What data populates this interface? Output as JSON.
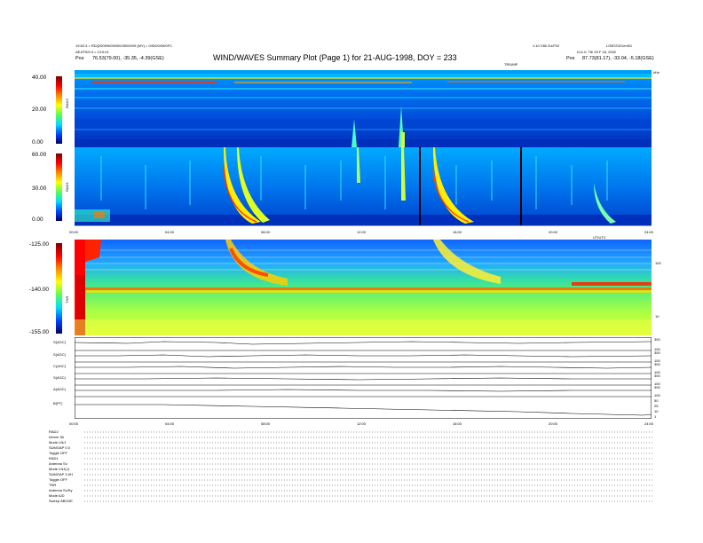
{
  "header": {
    "title": "WIND/WAVES Summary Plot (Page 1) for 21-AUG-1998, DOY = 233",
    "left_line1": "19:52:3 = RD/[2009/9/09/000/39/09/09 (MY) = 0/9/0/0/09/0FC",
    "left_line2": "AEJ/F9/9:3 = 13:0:01",
    "left_pos_label": "Pos",
    "left_pos_value": "76.53(79.00), -35.35, -4.39(GSE)",
    "right_line1": "1:10 V80 2U/F02",
    "right_line1b": "LOB7/02/1/m5/1",
    "right_line2": "D:A.V: T8/ 29 F 18, 2002",
    "right_pos_label": "Pos",
    "right_pos_value": "87.73(81.17), -33.04, -5.18(GSE)",
    "small_tr_label": "TRIUMP",
    "small_tr_unit": "kHz"
  },
  "colorbars": [
    {
      "name": "RAD2",
      "ticks": [
        "40.00",
        "20.00",
        "0.00"
      ],
      "label": "RAD2"
    },
    {
      "name": "RAD1",
      "ticks": [
        "60.00",
        "30.00",
        "0.00"
      ],
      "label": "RAD1"
    },
    {
      "name": "TNR",
      "ticks": [
        "-125.00",
        "-140.00",
        "-155.00"
      ],
      "label": "TNR"
    }
  ],
  "time_axis": {
    "labels": [
      "00:00",
      "04:00",
      "08:00",
      "12:00",
      "16:00",
      "20:00",
      "24:00"
    ],
    "unit_label": "UT/UTC"
  },
  "tnr_right_ticks": [
    "100",
    "10"
  ],
  "linepanels": [
    {
      "label": "S(AGC)",
      "right_ticks": [
        "300",
        "200",
        "100"
      ]
    },
    {
      "label": "S(AGC)",
      "right_ticks": [
        "300",
        "200",
        "100"
      ]
    },
    {
      "label": "C(AGC)",
      "right_ticks": [
        "300",
        "200",
        "100"
      ]
    },
    {
      "label": "S(AGC)",
      "right_ticks": [
        "300",
        "200",
        "100"
      ]
    },
    {
      "label": "A(AGC)",
      "right_ticks": [
        "300",
        "200",
        "100"
      ]
    },
    {
      "label": "B(PT)",
      "right_ticks": [
        "50",
        "25",
        "10",
        "5",
        "1"
      ]
    }
  ],
  "legend_rows": [
    {
      "k": "RAD2",
      "v": ""
    },
    {
      "k": "Inform",
      "v": "Sk"
    },
    {
      "k": "Mode",
      "v": "LN/J"
    },
    {
      "k": "SUMOAP",
      "v": "0.0"
    },
    {
      "k": "Toggle",
      "v": "OFF"
    },
    {
      "k": "RAD1",
      "v": ""
    },
    {
      "k": "Antenna",
      "v": "Sx"
    },
    {
      "k": "Mode",
      "v": "LNJ(J)"
    },
    {
      "k": "SUMOAP",
      "v": "3.0H"
    },
    {
      "k": "Toggle",
      "v": "OFF"
    },
    {
      "k": "TNR",
      "v": ""
    },
    {
      "k": "Antenna",
      "v": "Sx/Sy"
    },
    {
      "k": "Mode",
      "v": "A/D"
    },
    {
      "k": "Sweep",
      "v": "ABCDE"
    }
  ],
  "chart_data": {
    "type": "heatmap",
    "title": "WIND/WAVES Summary Plot (Page 1) for 21-AUG-1998, DOY = 233",
    "x_range_hours": [
      0,
      24
    ],
    "panels": [
      {
        "name": "RAD2",
        "zlim": [
          0,
          40
        ]
      },
      {
        "name": "RAD1",
        "zlim": [
          0,
          60
        ]
      },
      {
        "name": "TNR",
        "zlim": [
          -155,
          -125
        ]
      }
    ],
    "burst_times_hours": [
      5.9,
      6.3,
      11.4,
      13.6,
      14.8,
      21.7
    ],
    "data_gap_times_hours": [
      14.3,
      18.5
    ]
  }
}
